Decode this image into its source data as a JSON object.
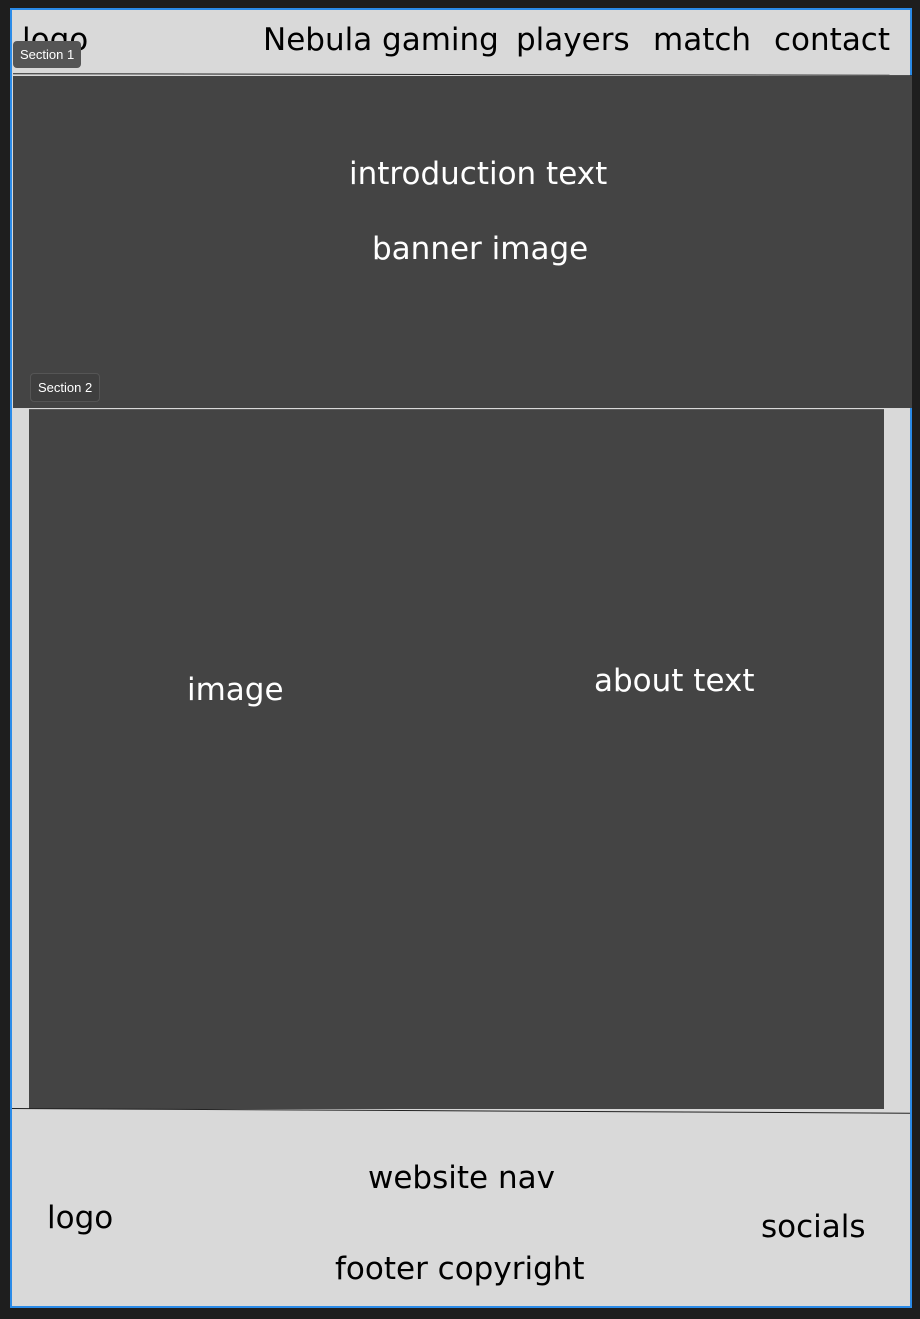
{
  "header": {
    "logo": "logo",
    "nav": [
      "Nebula gaming",
      "players",
      "match",
      "contact"
    ]
  },
  "section_tags": {
    "section1": "Section 1",
    "section2": "Section 2"
  },
  "hero": {
    "intro": "introduction text",
    "banner": "banner image"
  },
  "about": {
    "image": "image",
    "text": "about text"
  },
  "footer": {
    "logo": "logo",
    "nav": "website nav",
    "copyright": "footer copyright",
    "socials": "socials"
  },
  "colors": {
    "frame_border": "#2b8be8",
    "section_bg": "#444444",
    "page_bg": "#d9d9d9"
  }
}
